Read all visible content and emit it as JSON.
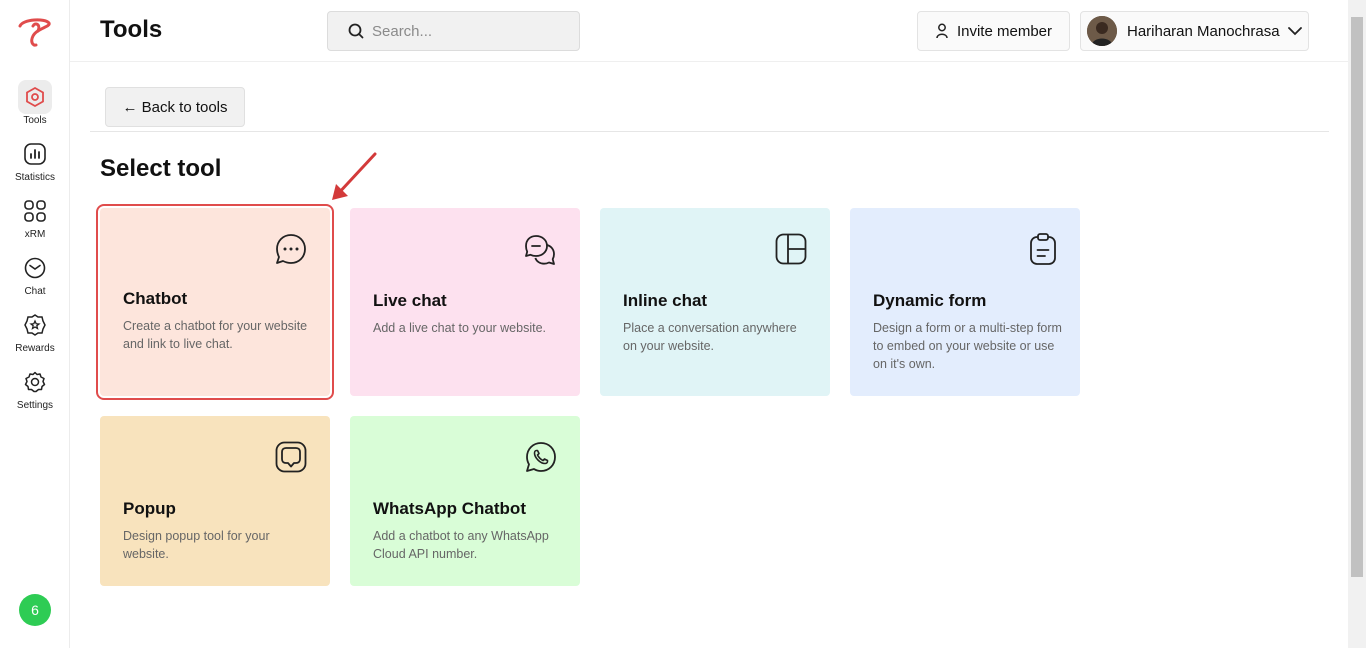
{
  "header": {
    "title": "Tools",
    "search_placeholder": "Search...",
    "invite_label": "Invite member",
    "user_name": "Hariharan Manochrasa"
  },
  "sidebar": {
    "items": [
      {
        "label": "Tools",
        "icon": "hexagon-icon",
        "active": true
      },
      {
        "label": "Statistics",
        "icon": "bar-chart-icon"
      },
      {
        "label": "xRM",
        "icon": "grid-icon"
      },
      {
        "label": "Chat",
        "icon": "chat-bubble-icon"
      },
      {
        "label": "Rewards",
        "icon": "badge-icon"
      },
      {
        "label": "Settings",
        "icon": "gear-icon"
      }
    ],
    "notification_count": "6"
  },
  "main": {
    "back_label": "← Back to tools",
    "section_title": "Select tool",
    "tools": [
      {
        "title": "Chatbot",
        "desc": "Create a chatbot for your website and link to live chat.",
        "color": "#fde5dc",
        "icon": "chat-dots-icon",
        "selected": true
      },
      {
        "title": "Live chat",
        "desc": "Add a live chat to your website.",
        "color": "#fde1ef",
        "icon": "chat-bubbles-icon"
      },
      {
        "title": "Inline chat",
        "desc": "Place a conversation anywhere on your website.",
        "color": "#e0f4f6",
        "icon": "layout-icon"
      },
      {
        "title": "Dynamic form",
        "desc": "Design a form or a multi-step form to embed on your website or use on it's own.",
        "color": "#e3edfd",
        "icon": "clipboard-icon"
      },
      {
        "title": "Popup",
        "desc": "Design popup tool for your website.",
        "color": "#f8e3bd",
        "icon": "popup-icon"
      },
      {
        "title": "WhatsApp Chatbot",
        "desc": "Add a chatbot to any WhatsApp Cloud API number.",
        "color": "#d9fdd7",
        "icon": "whatsapp-icon"
      }
    ]
  },
  "colors": {
    "brand": "#e04c4c",
    "badge": "#2ecc54"
  }
}
